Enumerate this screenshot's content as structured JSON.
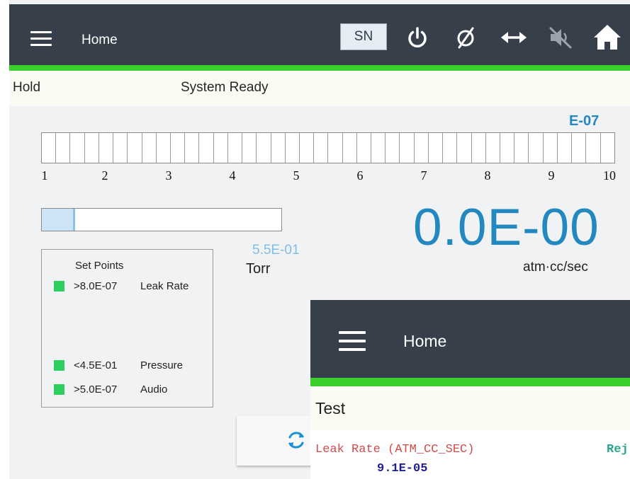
{
  "header": {
    "title": "Home",
    "sn_label": "SN",
    "icons": [
      "power-icon",
      "empty-set-icon",
      "left-right-arrow-icon",
      "speaker-muted-icon",
      "home-icon"
    ]
  },
  "status": {
    "state": "Hold",
    "message": "System Ready"
  },
  "scale": {
    "exponent": "E-07",
    "ticks": [
      "1",
      "2",
      "3",
      "4",
      "5",
      "6",
      "7",
      "8",
      "9",
      "10"
    ],
    "cells": 40
  },
  "pressure": {
    "value": "5.5E-01",
    "unit": "Torr",
    "fill_fraction": 0.14
  },
  "leak_rate": {
    "value": "0.0E-00",
    "unit": "atm·cc/sec"
  },
  "set_points": {
    "title": "Set Points",
    "items": [
      {
        "value": ">8.0E-07",
        "name": "Leak Rate"
      },
      {
        "value": "<4.5E-01",
        "name": "Pressure"
      },
      {
        "value": ">5.0E-07",
        "name": "Audio"
      }
    ]
  },
  "overlay": {
    "title": "Home",
    "test_label": "Test",
    "leak_label": "Leak Rate (ATM_CC_SEC)",
    "reject_label": "Rej",
    "leak_value": "9.1E-05"
  },
  "colors": {
    "header_bg": "#363f4a",
    "accent_green": "#39d02c",
    "value_blue": "#2388bf",
    "setpoint_green": "#2fcf5f"
  }
}
